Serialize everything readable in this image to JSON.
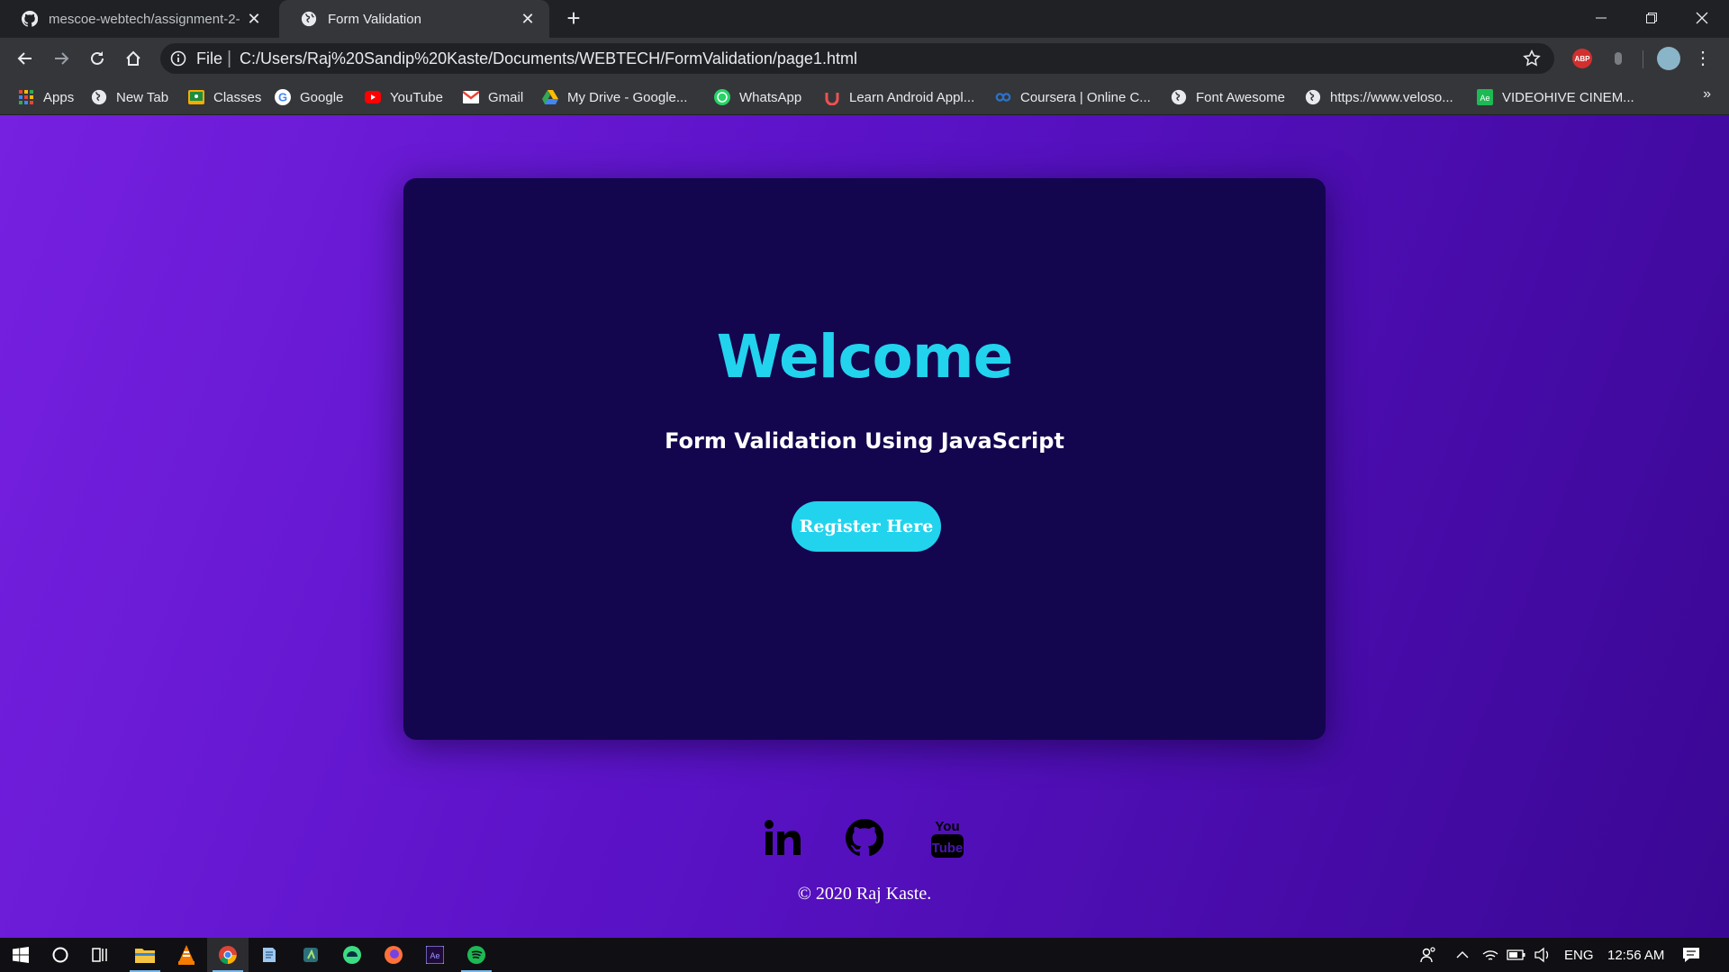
{
  "browser": {
    "tabs": [
      {
        "title": "mescoe-webtech/assignment-2-",
        "icon": "github-icon",
        "active": false
      },
      {
        "title": "Form Validation",
        "icon": "globe-icon",
        "active": true
      }
    ],
    "address": {
      "scheme_label": "File",
      "url": "C:/Users/Raj%20Sandip%20Kaste/Documents/WEBTECH/FormValidation/page1.html"
    },
    "extensions": {
      "abp_label": "ABP"
    },
    "bookmarks": [
      {
        "label": "Apps",
        "icon": "apps-grid-icon"
      },
      {
        "label": "New Tab",
        "icon": "globe-icon"
      },
      {
        "label": "Classes",
        "icon": "google-classroom-icon"
      },
      {
        "label": "Google",
        "icon": "google-icon"
      },
      {
        "label": "YouTube",
        "icon": "youtube-icon"
      },
      {
        "label": "Gmail",
        "icon": "gmail-icon"
      },
      {
        "label": "My Drive - Google...",
        "icon": "google-drive-icon"
      },
      {
        "label": "WhatsApp",
        "icon": "whatsapp-icon"
      },
      {
        "label": "Learn Android Appl...",
        "icon": "udemy-icon"
      },
      {
        "label": "Coursera | Online C...",
        "icon": "coursera-icon"
      },
      {
        "label": "Font Awesome",
        "icon": "globe-icon"
      },
      {
        "label": "https://www.veloso...",
        "icon": "globe-icon"
      },
      {
        "label": "VIDEOHIVE CINEM...",
        "icon": "after-effects-icon"
      }
    ],
    "bookmarks_overflow": "»"
  },
  "page": {
    "heading": "Welcome",
    "subtitle": "Form Validation Using JavaScript",
    "register_label": "Register Here",
    "socials": [
      "linkedin-icon",
      "github-icon",
      "youtube-icon"
    ],
    "footer": "© 2020 Raj Kaste.",
    "colors": {
      "accent": "#22d3ee",
      "card": "#14054f",
      "bg_start": "#7620e0",
      "bg_end": "#3a0794"
    }
  },
  "taskbar": {
    "apps": [
      "file-explorer-icon",
      "vlc-icon",
      "chrome-icon",
      "notepad-icon",
      "android-studio-icon",
      "android-icon",
      "firefox-icon",
      "after-effects-icon",
      "spotify-icon"
    ],
    "language": "ENG",
    "time": "12:56 AM"
  }
}
